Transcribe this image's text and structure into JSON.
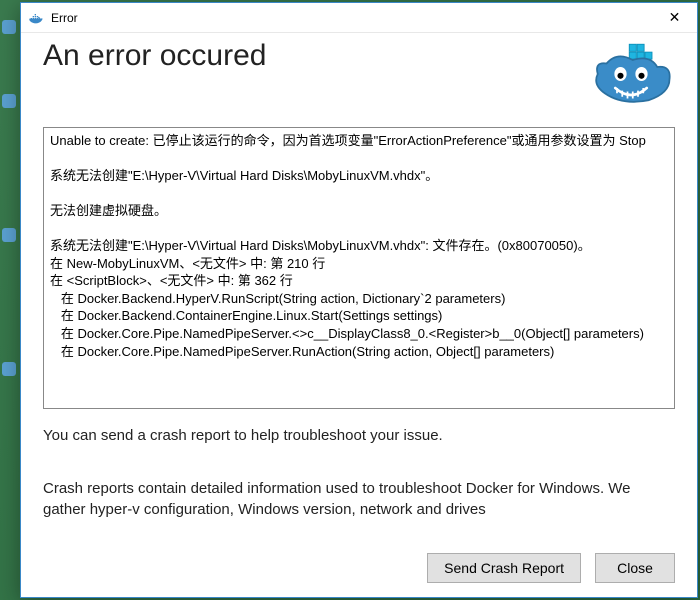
{
  "titlebar": {
    "title": "Error",
    "close_glyph": "✕"
  },
  "heading": "An error occured",
  "error_text": "Unable to create: 已停止该运行的命令，因为首选项变量\"ErrorActionPreference\"或通用参数设置为 Stop\n\n系统无法创建\"E:\\Hyper-V\\Virtual Hard Disks\\MobyLinuxVM.vhdx\"。\n\n无法创建虚拟硬盘。\n\n系统无法创建\"E:\\Hyper-V\\Virtual Hard Disks\\MobyLinuxVM.vhdx\": 文件存在。(0x80070050)。\n在 New-MobyLinuxVM、<无文件> 中: 第 210 行\n在 <ScriptBlock>、<无文件> 中: 第 362 行\n   在 Docker.Backend.HyperV.RunScript(String action, Dictionary`2 parameters)\n   在 Docker.Backend.ContainerEngine.Linux.Start(Settings settings)\n   在 Docker.Core.Pipe.NamedPipeServer.<>c__DisplayClass8_0.<Register>b__0(Object[] parameters)\n   在 Docker.Core.Pipe.NamedPipeServer.RunAction(String action, Object[] parameters)",
  "prompt_line1": "You can send a crash report to help troubleshoot your issue.",
  "prompt_line2": "Crash reports contain detailed information used to troubleshoot Docker for Windows. We gather hyper-v configuration, Windows version, network and drives",
  "buttons": {
    "send": "Send Crash Report",
    "close": "Close"
  }
}
